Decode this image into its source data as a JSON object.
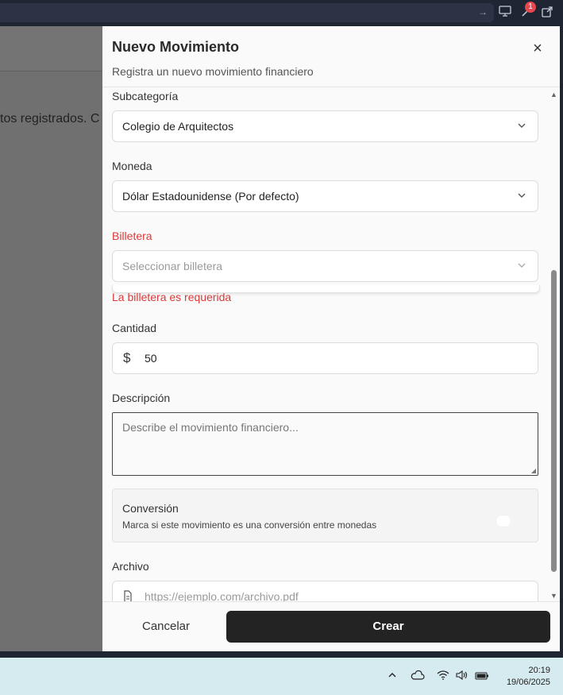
{
  "topbar": {
    "notification_count": "1",
    "icons": [
      "arrow-right-icon",
      "monitor-icon",
      "tool-icon",
      "external-link-icon"
    ]
  },
  "background": {
    "text": "tos registrados. C"
  },
  "modal": {
    "title": "Nuevo Movimiento",
    "subtitle": "Registra un nuevo movimiento financiero",
    "close_label": "×"
  },
  "form": {
    "subcategory": {
      "label": "Subcategoría",
      "value": "Colegio de Arquitectos"
    },
    "currency": {
      "label": "Moneda",
      "value": "Dólar Estadounidense (Por defecto)"
    },
    "wallet": {
      "label": "Billetera",
      "placeholder": "Seleccionar billetera",
      "error": "La billetera es requerida"
    },
    "amount": {
      "label": "Cantidad",
      "symbol": "$",
      "value": "50"
    },
    "description": {
      "label": "Descripción",
      "placeholder": "Describe el movimiento financiero..."
    },
    "conversion": {
      "title": "Conversión",
      "description": "Marca si este movimiento es una conversión entre monedas",
      "enabled": false
    },
    "file": {
      "label": "Archivo",
      "placeholder": "https://ejemplo.com/archivo.pdf"
    }
  },
  "footer": {
    "cancel_label": "Cancelar",
    "create_label": "Crear"
  },
  "taskbar": {
    "time": "20:19",
    "date": "19/06/2025",
    "icons": [
      "chevron-up-icon",
      "cloud-icon",
      "wifi-icon",
      "volume-icon",
      "battery-icon"
    ]
  },
  "colors": {
    "error": "#d93a3a",
    "primary_button": "#232323",
    "overlay": "#707070"
  }
}
